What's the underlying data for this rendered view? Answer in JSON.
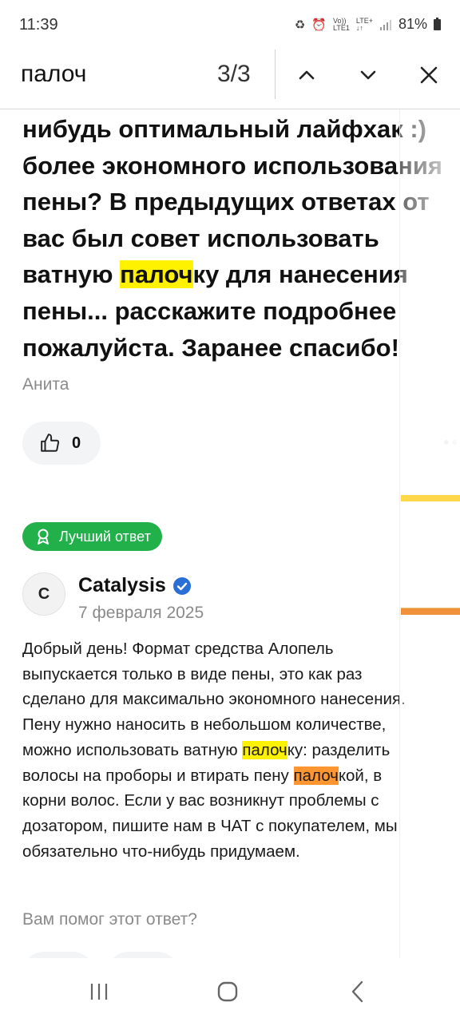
{
  "status": {
    "time": "11:39",
    "volte_label_top": "Vo))",
    "volte_label_bottom": "LTE1",
    "lte_label": "LTE+",
    "battery": "81%"
  },
  "find": {
    "query": "палоч",
    "count": "3/3"
  },
  "question": {
    "lines": [
      [
        "нибудь оптимальный лайфхак :)"
      ],
      [
        "более экономного использования"
      ],
      [
        "пены? В предыдущих ответах от"
      ],
      [
        "вас был совет использовать"
      ],
      [
        "ватную ",
        "палоч",
        "ку для нанесения"
      ],
      [
        "пены... расскажите подробнее"
      ],
      [
        "пожалуйста. Заранее спасибо!"
      ]
    ],
    "author": "Анита",
    "likes": "0"
  },
  "answer": {
    "badge": "Лучший ответ",
    "avatar_letter": "C",
    "author": "Catalysis",
    "date": "7 февраля 2025",
    "lines": [
      [
        "Добрый день! Формат средства Алопель"
      ],
      [
        "выпускается только в виде пены, это как раз"
      ],
      [
        "сделано для максимально экономного нанесения."
      ],
      [
        "Пену нужно наносить в небольшом количестве,"
      ],
      [
        "можно использовать ватную ",
        "палоч",
        "ку: разделить"
      ],
      [
        "волосы на проборы и втирать пену ",
        "палоч",
        "кой, в"
      ],
      [
        "корни волос. Если у вас возникнут проблемы с"
      ],
      [
        "дозатором, пишите нам в ЧАТ с покупателем, мы"
      ],
      [
        "обязательно что-нибудь придумаем."
      ]
    ],
    "helpful_question": "Вам помог этот ответ?"
  },
  "colors": {
    "highlight": "#fff200",
    "highlight_active": "#ff9632",
    "best_badge": "#22b04b",
    "verified": "#2a6fd6"
  },
  "icons": [
    "alarm-icon",
    "recycle-icon",
    "signal-icon",
    "battery-icon",
    "chevron-up-icon",
    "chevron-down-icon",
    "close-icon",
    "thumbs-up-icon",
    "ribbon-icon",
    "verified-icon",
    "recent-apps-icon",
    "home-icon",
    "back-icon"
  ]
}
